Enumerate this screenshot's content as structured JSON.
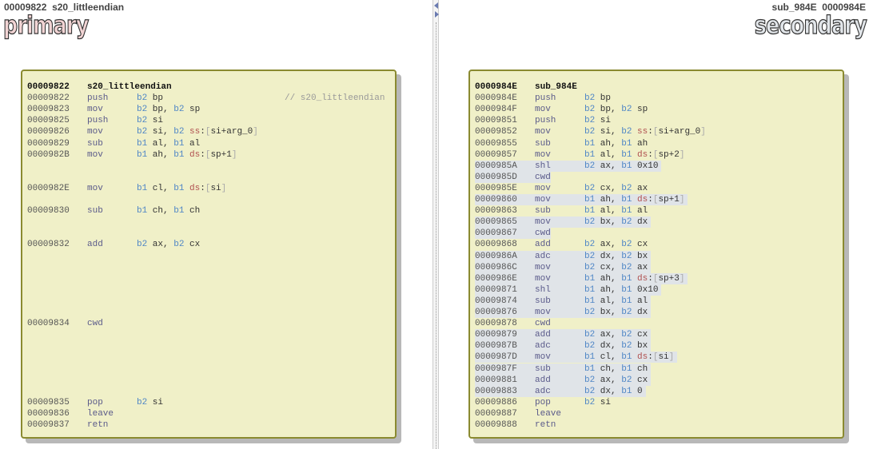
{
  "primary": {
    "address": "00009822",
    "function_name": "s20_littleendian",
    "logo": "primary",
    "logo_color": "#f2d4d4",
    "header": {
      "address": "00009822",
      "name": "s20_littleendian"
    },
    "rows": [
      {
        "slot": 1,
        "address": "00009822",
        "mnemonic": "push",
        "operands": "b2 bp",
        "comment": "// s20_littleendian"
      },
      {
        "slot": 2,
        "address": "00009823",
        "mnemonic": "mov",
        "operands": "b2 bp, b2 sp"
      },
      {
        "slot": 3,
        "address": "00009825",
        "mnemonic": "push",
        "operands": "b2 si"
      },
      {
        "slot": 4,
        "address": "00009826",
        "mnemonic": "mov",
        "operands": "b2 si, b2 ss:[si+arg_0]"
      },
      {
        "slot": 5,
        "address": "00009829",
        "mnemonic": "sub",
        "operands": "b1 al, b1 al"
      },
      {
        "slot": 6,
        "address": "0000982B",
        "mnemonic": "mov",
        "operands": "b1 ah, b1 ds:[sp+1]"
      },
      {
        "slot": 9,
        "address": "0000982E",
        "mnemonic": "mov",
        "operands": "b1 cl, b1 ds:[si]"
      },
      {
        "slot": 11,
        "address": "00009830",
        "mnemonic": "sub",
        "operands": "b1 ch, b1 ch"
      },
      {
        "slot": 14,
        "address": "00009832",
        "mnemonic": "add",
        "operands": "b2 ax, b2 cx"
      },
      {
        "slot": 21,
        "address": "00009834",
        "mnemonic": "cwd",
        "operands": ""
      },
      {
        "slot": 28,
        "address": "00009835",
        "mnemonic": "pop",
        "operands": "b2 si"
      },
      {
        "slot": 29,
        "address": "00009836",
        "mnemonic": "leave",
        "operands": ""
      },
      {
        "slot": 30,
        "address": "00009837",
        "mnemonic": "retn",
        "operands": ""
      }
    ]
  },
  "secondary": {
    "address": "0000984E",
    "function_name": "sub_984E",
    "logo": "secondary",
    "logo_color": "#e2e6ea",
    "header": {
      "address": "0000984E",
      "name": "sub_984E"
    },
    "rows": [
      {
        "address": "0000984E",
        "mnemonic": "push",
        "operands": "b2 bp"
      },
      {
        "address": "0000984F",
        "mnemonic": "mov",
        "operands": "b2 bp, b2 sp"
      },
      {
        "address": "00009851",
        "mnemonic": "push",
        "operands": "b2 si"
      },
      {
        "address": "00009852",
        "mnemonic": "mov",
        "operands": "b2 si, b2 ss:[si+arg_0]"
      },
      {
        "address": "00009855",
        "mnemonic": "sub",
        "operands": "b1 ah, b1 ah"
      },
      {
        "address": "00009857",
        "mnemonic": "mov",
        "operands": "b1 al, b1 ds:[sp+2]"
      },
      {
        "address": "0000985A",
        "mnemonic": "shl",
        "operands": "b2 ax, b1 0x10",
        "unmatched": true
      },
      {
        "address": "0000985D",
        "mnemonic": "cwd",
        "operands": "",
        "unmatched": true
      },
      {
        "address": "0000985E",
        "mnemonic": "mov",
        "operands": "b2 cx, b2 ax"
      },
      {
        "address": "00009860",
        "mnemonic": "mov",
        "operands": "b1 ah, b1 ds:[sp+1]",
        "unmatched": true
      },
      {
        "address": "00009863",
        "mnemonic": "sub",
        "operands": "b1 al, b1 al"
      },
      {
        "address": "00009865",
        "mnemonic": "mov",
        "operands": "b2 bx, b2 dx",
        "unmatched": true
      },
      {
        "address": "00009867",
        "mnemonic": "cwd",
        "operands": "",
        "unmatched": true
      },
      {
        "address": "00009868",
        "mnemonic": "add",
        "operands": "b2 ax, b2 cx"
      },
      {
        "address": "0000986A",
        "mnemonic": "adc",
        "operands": "b2 dx, b2 bx",
        "unmatched": true
      },
      {
        "address": "0000986C",
        "mnemonic": "mov",
        "operands": "b2 cx, b2 ax",
        "unmatched": true
      },
      {
        "address": "0000986E",
        "mnemonic": "mov",
        "operands": "b1 ah, b1 ds:[sp+3]",
        "unmatched": true
      },
      {
        "address": "00009871",
        "mnemonic": "shl",
        "operands": "b1 ah, b1 0x10",
        "unmatched": true
      },
      {
        "address": "00009874",
        "mnemonic": "sub",
        "operands": "b1 al, b1 al",
        "unmatched": true
      },
      {
        "address": "00009876",
        "mnemonic": "mov",
        "operands": "b2 bx, b2 dx",
        "unmatched": true
      },
      {
        "address": "00009878",
        "mnemonic": "cwd",
        "operands": ""
      },
      {
        "address": "00009879",
        "mnemonic": "add",
        "operands": "b2 ax, b2 cx",
        "unmatched": true
      },
      {
        "address": "0000987B",
        "mnemonic": "adc",
        "operands": "b2 dx, b2 bx",
        "unmatched": true
      },
      {
        "address": "0000987D",
        "mnemonic": "mov",
        "operands": "b1 cl, b1 ds:[si]",
        "unmatched": true
      },
      {
        "address": "0000987F",
        "mnemonic": "sub",
        "operands": "b1 ch, b1 ch",
        "unmatched": true
      },
      {
        "address": "00009881",
        "mnemonic": "add",
        "operands": "b2 ax, b2 cx",
        "unmatched": true
      },
      {
        "address": "00009883",
        "mnemonic": "adc",
        "operands": "b2 dx, b1 0",
        "unmatched": true
      },
      {
        "address": "00009886",
        "mnemonic": "pop",
        "operands": "b2 si"
      },
      {
        "address": "00009887",
        "mnemonic": "leave",
        "operands": ""
      },
      {
        "address": "00009888",
        "mnemonic": "retn",
        "operands": ""
      }
    ]
  },
  "colors": {
    "block_bg": "#f0f0c8",
    "block_border": "#8a8a30",
    "unmatched_bg": "#e0e4e8",
    "size_prefix": "#4f86c6",
    "segment": "#b05050"
  },
  "splitter_icons": [
    "arrow-left-icon",
    "arrow-right-icon"
  ]
}
